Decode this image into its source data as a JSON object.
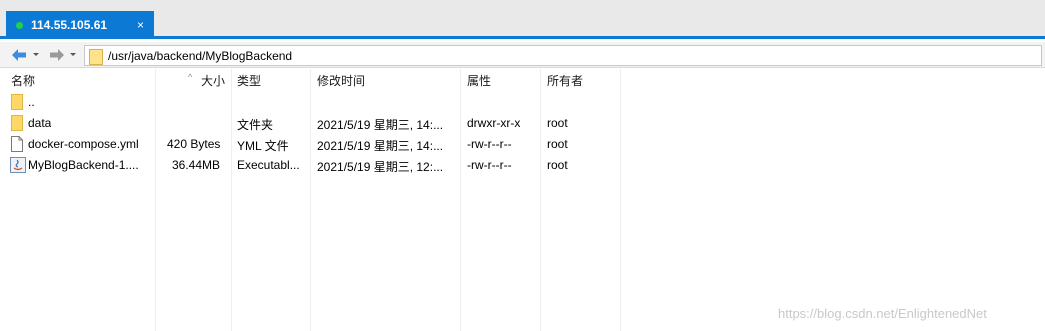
{
  "tab": {
    "title": "114.55.105.61",
    "close": "×"
  },
  "address": {
    "path": "/usr/java/backend/MyBlogBackend"
  },
  "columns": {
    "name": "名称",
    "size": "大小",
    "type": "类型",
    "modified": "修改时间",
    "attrs": "属性",
    "owner": "所有者"
  },
  "sort_indicator": "^",
  "rows": [
    {
      "icon": "folder-icon",
      "name": "..",
      "size": "",
      "type": "",
      "modified": "",
      "attrs": "",
      "owner": ""
    },
    {
      "icon": "folder-icon",
      "name": "data",
      "size": "",
      "type": "文件夹",
      "modified": "2021/5/19 星期三, 14:...",
      "attrs": "drwxr-xr-x",
      "owner": "root"
    },
    {
      "icon": "file-icon",
      "name": "docker-compose.yml",
      "size": "420 Bytes",
      "type": "YML 文件",
      "modified": "2021/5/19 星期三, 14:...",
      "attrs": "-rw-r--r--",
      "owner": "root"
    },
    {
      "icon": "java-archive-icon",
      "name": "MyBlogBackend-1....",
      "size": "36.44MB",
      "type": "Executabl...",
      "modified": "2021/5/19 星期三, 12:...",
      "attrs": "-rw-r--r--",
      "owner": "root"
    }
  ],
  "watermark": "https://blog.csdn.net/EnlightenedNet",
  "colors": {
    "accent": "#0c79d4",
    "connected": "#1fd14a",
    "folder": "#ffd766"
  }
}
